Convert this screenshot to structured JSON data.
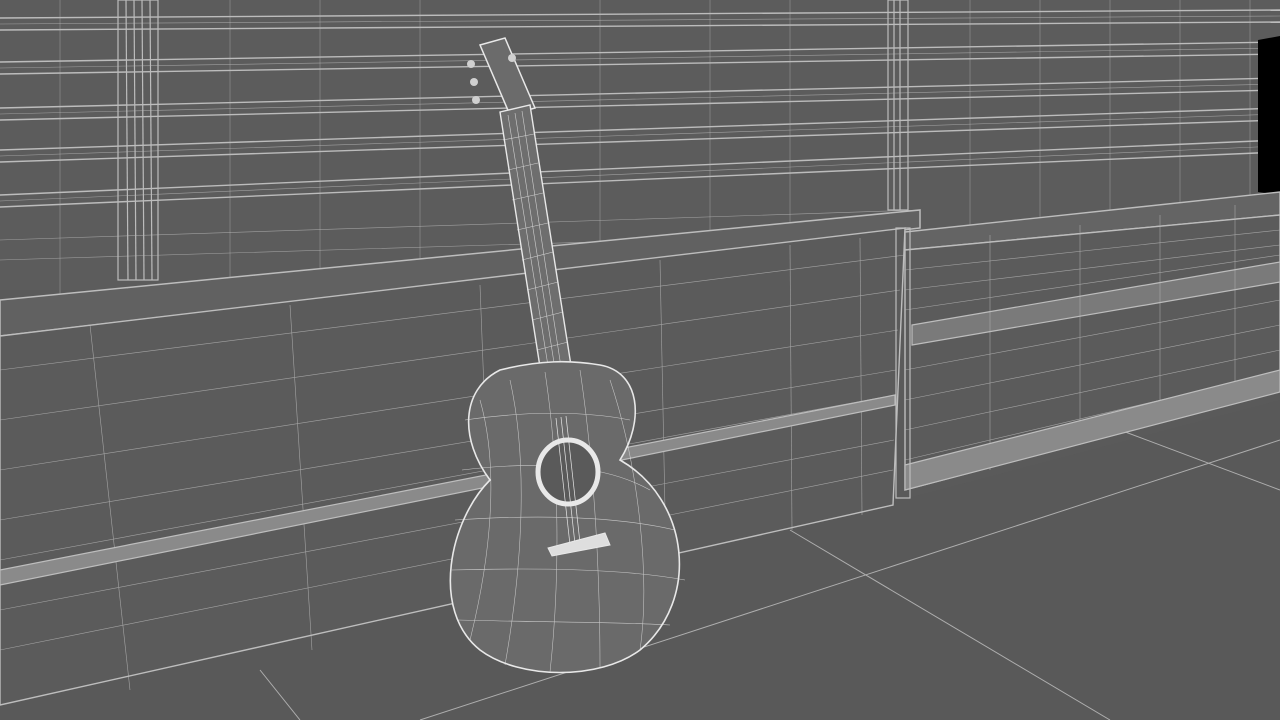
{
  "viewport": {
    "mode": "wireframe",
    "background_color": "#5a5a5a",
    "wire_color": "#c8c8c8",
    "highlight_wire_color": "#ffffff",
    "void_color": "#000000"
  },
  "scene": {
    "objects": [
      {
        "name": "acoustic-guitar",
        "icon": "guitar-wireframe"
      },
      {
        "name": "wall-cabinet-left",
        "icon": "box-wireframe"
      },
      {
        "name": "wall-cabinet-right",
        "icon": "box-wireframe"
      },
      {
        "name": "wall-shelves",
        "icon": "shelf-wireframe"
      },
      {
        "name": "floor-grid",
        "icon": "grid-plane"
      }
    ]
  }
}
